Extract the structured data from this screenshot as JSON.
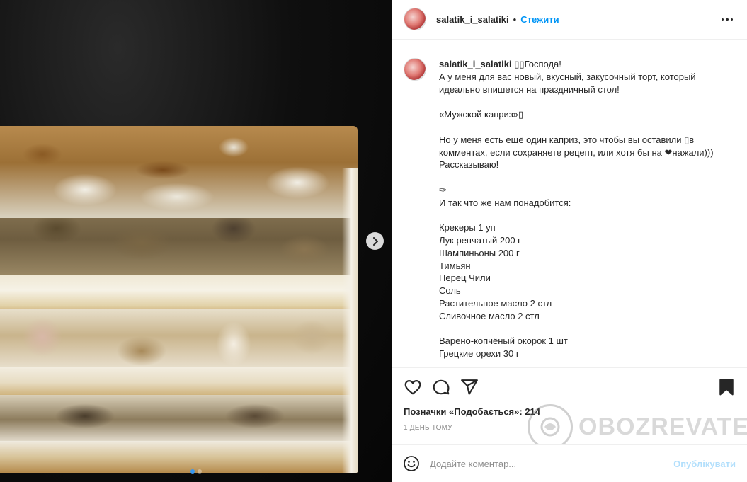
{
  "header": {
    "username": "salatik_i_salatiki",
    "separator": "•",
    "follow_label": "Стежити"
  },
  "caption": {
    "username": "salatik_i_salatiki",
    "lines": [
      "▯▯Господа!",
      "А у меня для вас новый, вкусный, закусочный торт, который",
      "идеально впишется на праздничный стол!",
      "",
      "«Мужской каприз»▯",
      "",
      "Но у меня есть ещё один каприз, это чтобы вы оставили ▯в",
      "комментах, если сохраняете рецепт, или хотя бы на ❤нажали)))",
      "Рассказываю!",
      "",
      "✑",
      "И так что же нам понадобится:",
      "",
      "Крекеры 1 уп",
      "Лук репчатый 200 г",
      "Шампиньоны 200 г",
      "Тимьян",
      "Перец Чили",
      "Соль",
      "Растительное масло 2 стл",
      "Сливочное масло 2 стл",
      "",
      "Варено-копчёный окорок 1 шт",
      "Грецкие орехи 30 г"
    ]
  },
  "likes": {
    "label": "Позначки «Подобається»:",
    "count": "214"
  },
  "time_ago": "1 день тому",
  "comment": {
    "placeholder": "Додайте коментар...",
    "publish_label": "Опублікувати"
  },
  "watermark": {
    "text": "OBOZREVATEL"
  },
  "carousel": {
    "slides": 2,
    "active_index": 0
  },
  "colors": {
    "accent": "#0095f6",
    "publish_disabled": "#b2dffc",
    "text": "#262626",
    "muted": "#8e8e8e"
  }
}
